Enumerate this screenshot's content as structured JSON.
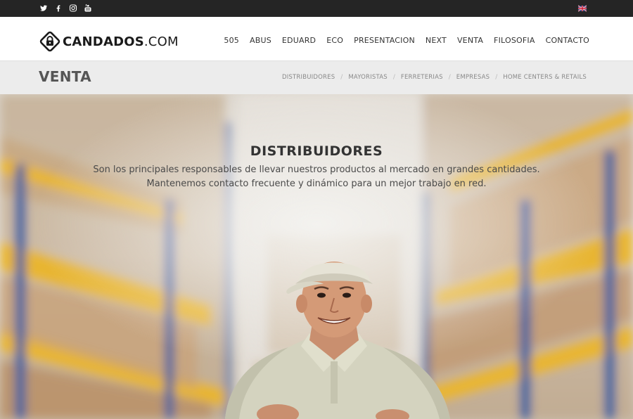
{
  "topbar": {
    "social": [
      {
        "icon": "twitter-icon"
      },
      {
        "icon": "facebook-icon"
      },
      {
        "icon": "instagram-icon"
      },
      {
        "icon": "youtube-icon"
      }
    ],
    "language_flag": "uk-flag-icon"
  },
  "header": {
    "logo": {
      "name": "CANDADOS",
      "suffix": ".COM"
    },
    "nav": [
      "505",
      "ABUS",
      "EDUARD",
      "ECO",
      "PRESENTACION",
      "NEXT",
      "VENTA",
      "FILOSOFIA",
      "CONTACTO"
    ]
  },
  "subheader": {
    "title": "VENTA",
    "crumbs": [
      "DISTRIBUIDORES",
      "MAYORISTAS",
      "FERRETERIAS",
      "EMPRESAS",
      "HOME CENTERS & RETAILS"
    ],
    "separator": "/"
  },
  "hero": {
    "title": "DISTRIBUIDORES",
    "line1": "Son los principales responsables de llevar nuestros productos al mercado en grandes cantidades.",
    "line2": "Mantenemos contacto frecuente y dinámico para un mejor trabajo en red."
  },
  "colors": {
    "topbar": "#252525",
    "subheader": "#ececec",
    "shelf_yellow": "#e8b530",
    "shelf_blue": "#2e5fa0"
  }
}
